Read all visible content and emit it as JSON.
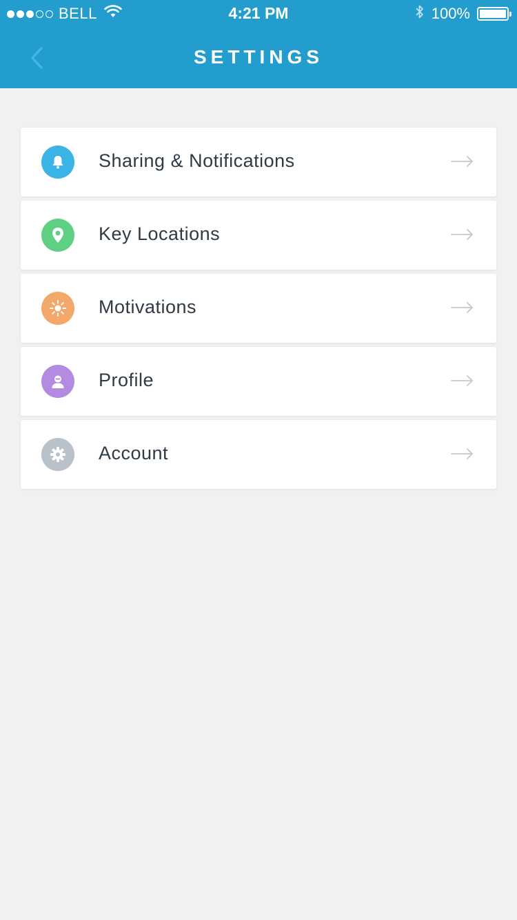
{
  "status_bar": {
    "carrier": "BELL",
    "time": "4:21 PM",
    "battery": "100%",
    "signal_bars_filled": 3,
    "signal_bars_total": 5,
    "battery_level": 1.0
  },
  "header": {
    "title": "SETTINGS"
  },
  "settings": {
    "items": [
      {
        "label": "Sharing & Notifications",
        "icon": "bell-icon",
        "color": "#3ab4e6"
      },
      {
        "label": "Key Locations",
        "icon": "location-pin-icon",
        "color": "#5fcf84"
      },
      {
        "label": "Motivations",
        "icon": "sun-icon",
        "color": "#f3a769"
      },
      {
        "label": "Profile",
        "icon": "person-icon",
        "color": "#b38be0"
      },
      {
        "label": "Account",
        "icon": "gear-icon",
        "color": "#b9c1ca"
      }
    ]
  },
  "colors": {
    "accent": "#239dcd",
    "background": "#f0f1f3",
    "back_arrow": "#3fb6ea"
  }
}
